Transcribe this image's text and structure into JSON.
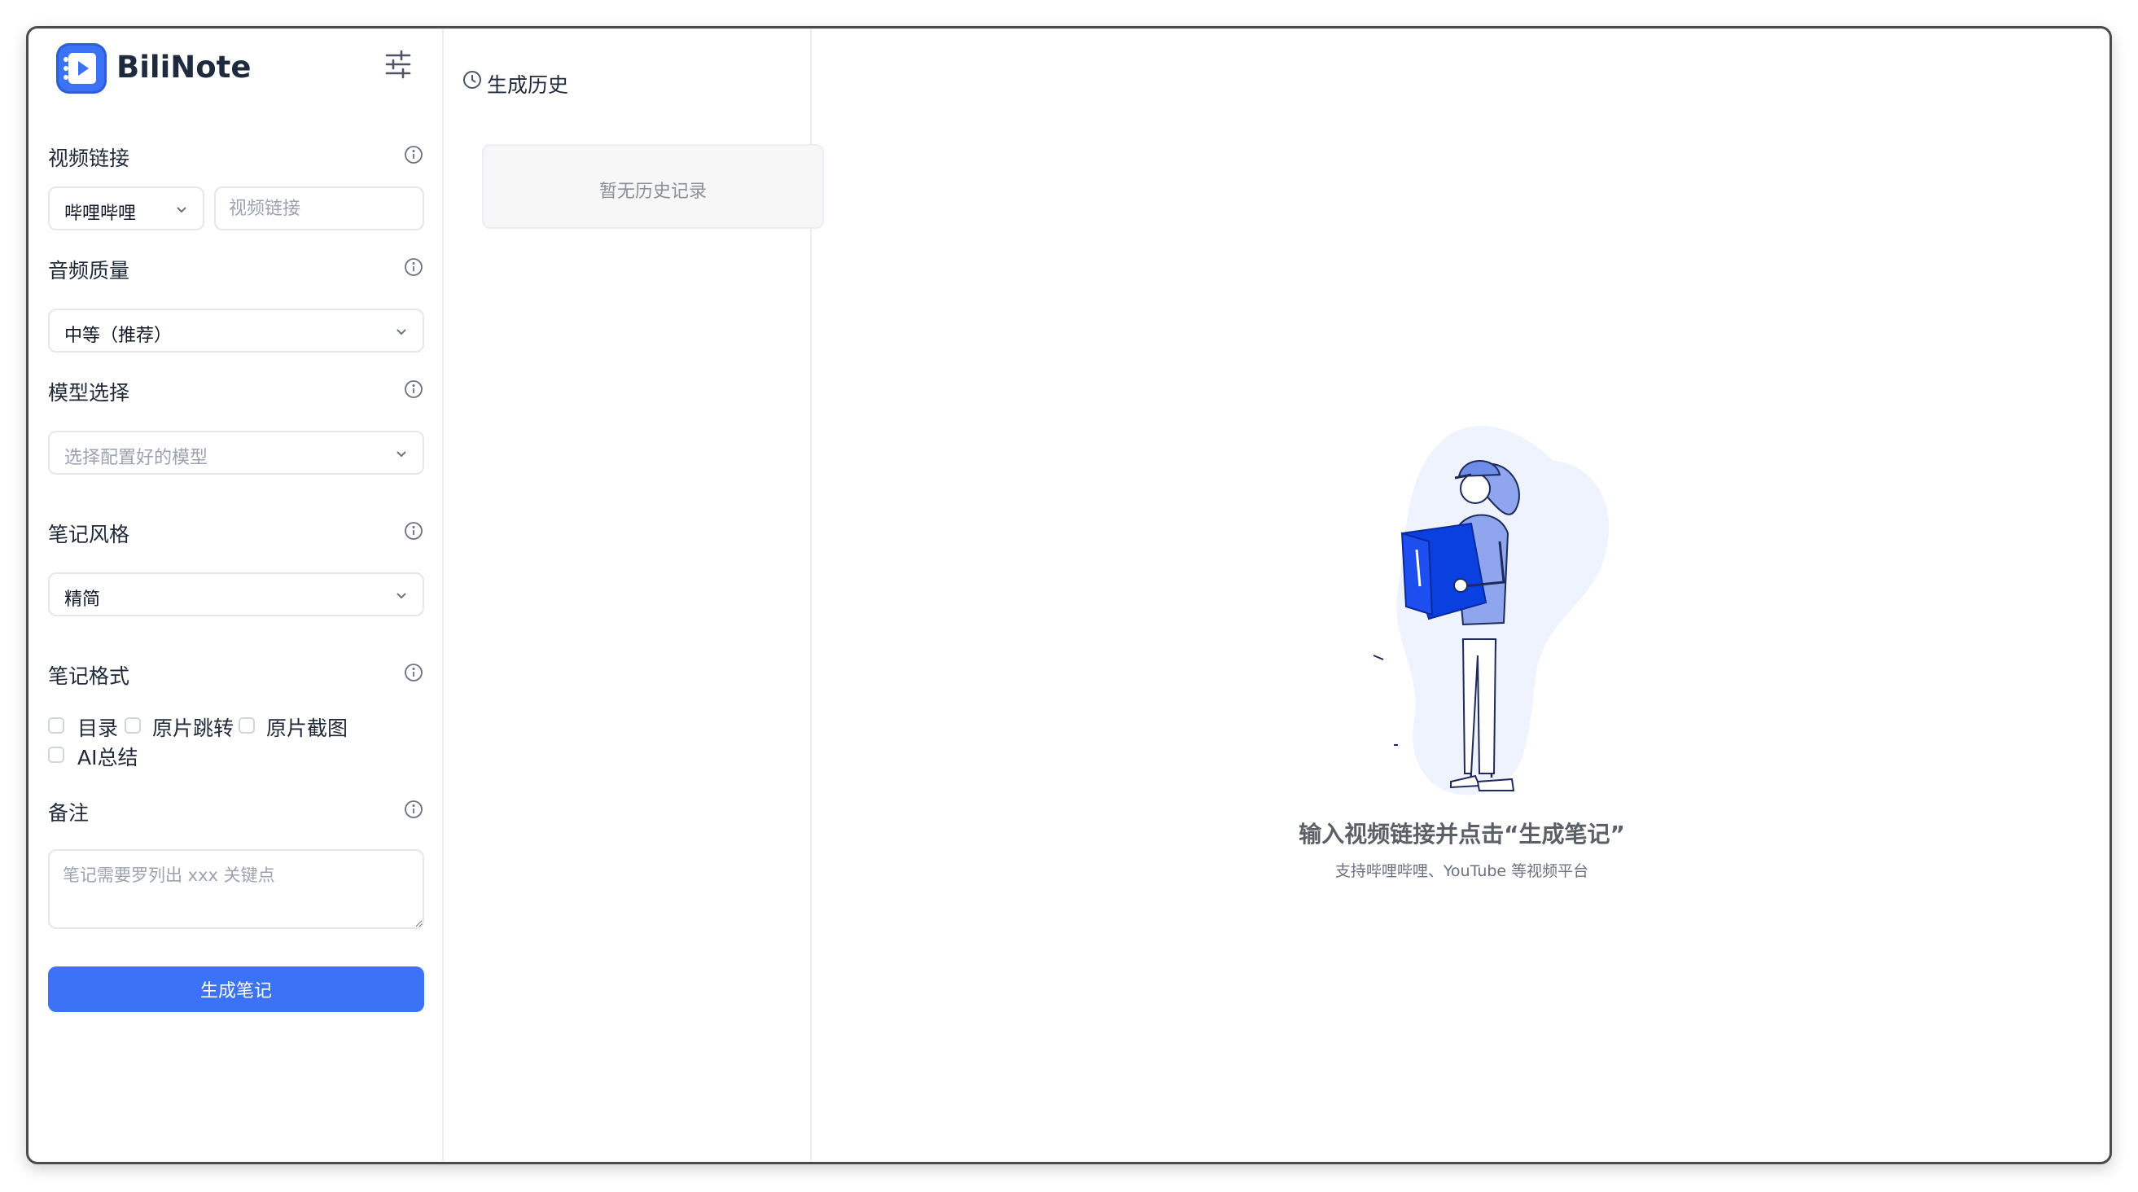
{
  "app": {
    "name": "BiliNote"
  },
  "form": {
    "video_link": {
      "label": "视频链接",
      "platform_value": "哔哩哔哩",
      "url_placeholder": "视频链接"
    },
    "audio_quality": {
      "label": "音频质量",
      "value": "中等（推荐）"
    },
    "model": {
      "label": "模型选择",
      "placeholder": "选择配置好的模型"
    },
    "note_style": {
      "label": "笔记风格",
      "value": "精简"
    },
    "note_format": {
      "label": "笔记格式",
      "options": [
        {
          "label": "目录",
          "checked": false
        },
        {
          "label": "原片跳转",
          "checked": false
        },
        {
          "label": "原片截图",
          "checked": false
        },
        {
          "label": "AI总结",
          "checked": false
        }
      ]
    },
    "remark": {
      "label": "备注",
      "placeholder": "笔记需要罗列出 xxx 关键点"
    },
    "submit_label": "生成笔记"
  },
  "history": {
    "title": "生成历史",
    "empty_text": "暂无历史记录"
  },
  "main": {
    "empty_title": "输入视频链接并点击“生成笔记”",
    "empty_subtitle": "支持哔哩哔哩、YouTube 等视频平台"
  },
  "icons": {
    "logo": "play-book-icon",
    "settings": "sliders-icon",
    "info": "info-icon",
    "history": "clock-icon",
    "chevron": "chevron-down-icon"
  },
  "colors": {
    "primary": "#3b72f6",
    "illustration_blue": "#0a3fe0",
    "illustration_light": "#eef3fe"
  }
}
